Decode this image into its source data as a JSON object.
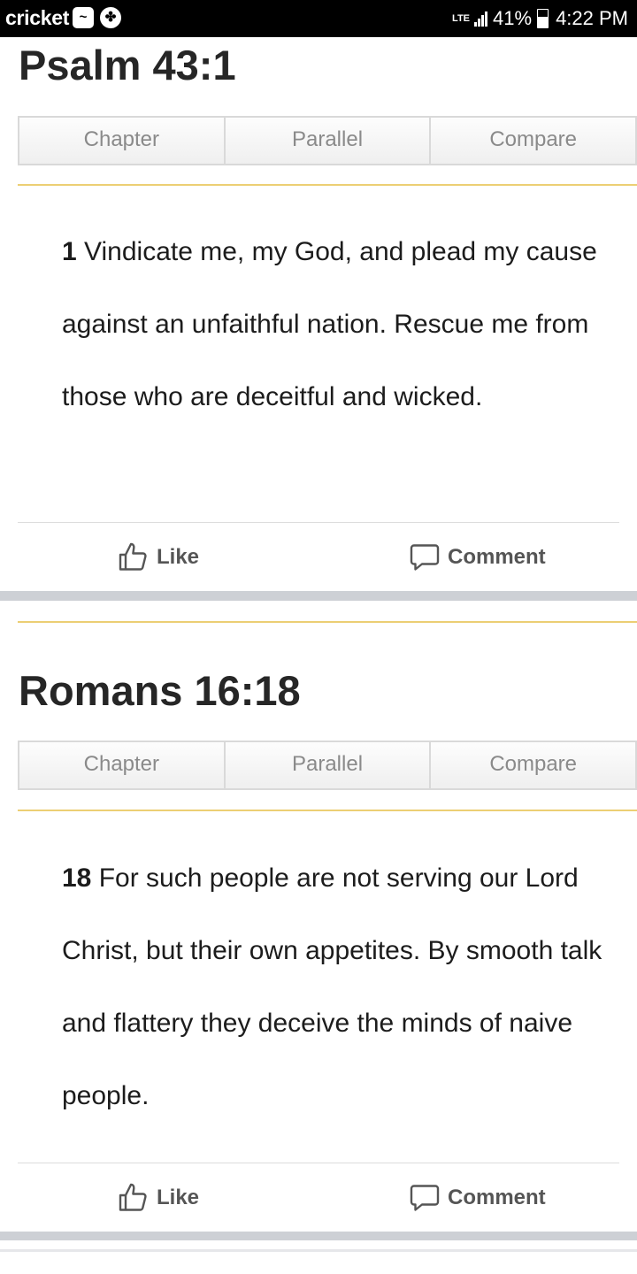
{
  "status_bar": {
    "carrier": "cricket",
    "network": "LTE",
    "battery": "41%",
    "time": "4:22 PM",
    "app_icons": [
      "cricket-wireless-icon",
      "game-controller-icon"
    ]
  },
  "cards": [
    {
      "title": "Psalm 43:1",
      "tabs": [
        "Chapter",
        "Parallel",
        "Compare"
      ],
      "verse_number": "1",
      "verse_text": "Vindicate me, my God, and plead my cause against an unfaithful nation. Rescue me from those who are deceitful and wicked.",
      "like_label": "Like",
      "comment_label": "Comment"
    },
    {
      "title": "Romans 16:18",
      "tabs": [
        "Chapter",
        "Parallel",
        "Compare"
      ],
      "verse_number": "18",
      "verse_text": "For such people are not serving our Lord Christ, but their own appetites. By smooth talk and flattery they deceive the minds of naive people.",
      "like_label": "Like",
      "comment_label": "Comment"
    }
  ],
  "colors": {
    "accent_gold": "#eccf74",
    "separator_grey": "#cdd0d5",
    "status_bar_bg": "#000000"
  }
}
